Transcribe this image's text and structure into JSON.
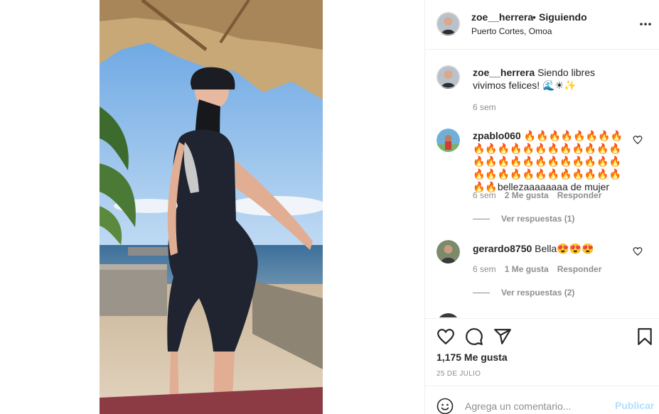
{
  "post": {
    "username": "zoe__herrera",
    "separator": "•",
    "follow_status": "Siguiendo",
    "location": "Puerto Cortes, Omoa",
    "caption_user": "zoe__herrera",
    "caption_text": "Siendo libres vivimos felices! 🌊☀✨",
    "caption_time": "6 sem",
    "likes": "1,175 Me gusta",
    "date": "25 DE JULIO"
  },
  "comments": [
    {
      "user": "zpablo060",
      "text": "🔥🔥🔥🔥🔥🔥🔥🔥🔥🔥🔥🔥🔥🔥🔥🔥🔥🔥🔥🔥🔥🔥🔥🔥🔥🔥🔥🔥🔥🔥🔥🔥🔥🔥🔥🔥🔥🔥🔥🔥🔥🔥🔥🔥🔥🔥bellezaaaaaaaa de mujer",
      "time": "6 sem",
      "likes": "2 Me gusta",
      "reply": "Responder",
      "replies": "Ver respuestas (1)"
    },
    {
      "user": "gerardo8750",
      "text": "Bella😍😍😍",
      "time": "6 sem",
      "likes": "1 Me gusta",
      "reply": "Responder",
      "replies": "Ver respuestas (2)"
    }
  ],
  "composer": {
    "placeholder": "Agrega un comentario...",
    "publish_label": "Publicar"
  },
  "colors": {
    "text": "#262626",
    "secondary": "#8e8e8e",
    "publish_disabled": "#b2dffc",
    "border": "#efefef"
  },
  "icons": {
    "more": "more-horizontal-icon",
    "like": "heart-icon",
    "comment": "comment-icon",
    "share": "paper-plane-icon",
    "save": "bookmark-icon",
    "emoji": "smiley-icon"
  }
}
